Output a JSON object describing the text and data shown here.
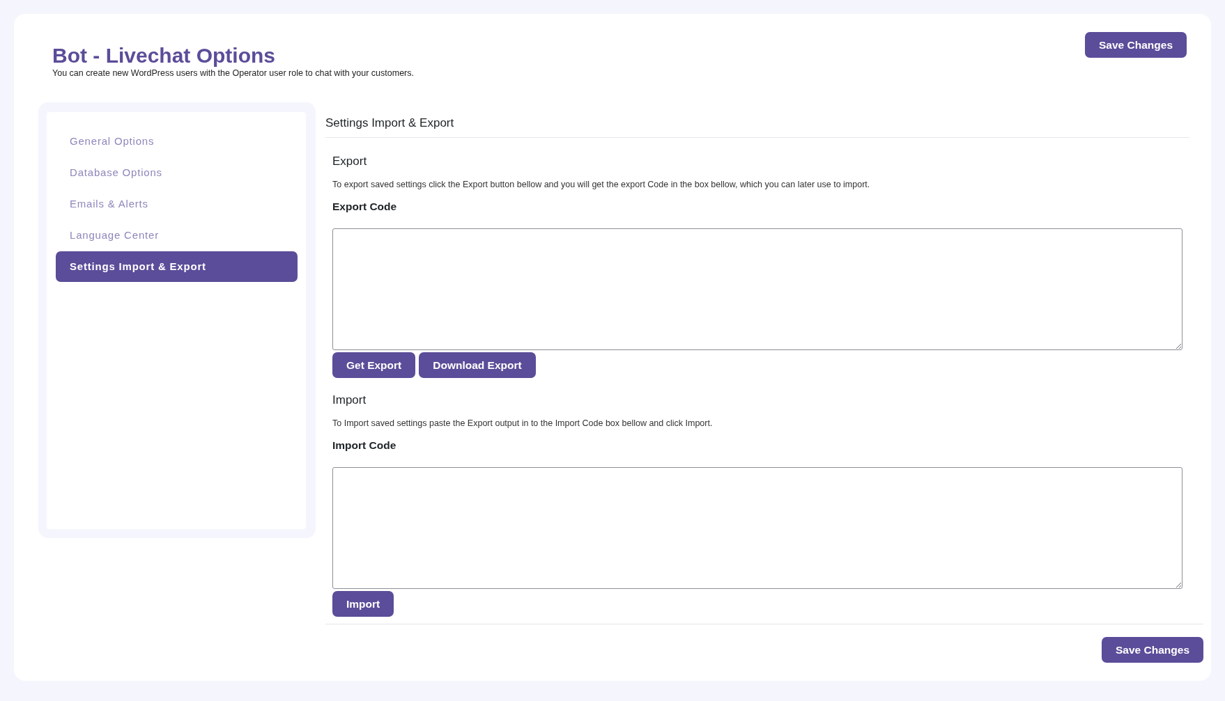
{
  "header": {
    "title": "Bot - Livechat Options",
    "subtitle": "You can create new WordPress users with the Operator user role to chat with your customers.",
    "save_button": "Save Changes"
  },
  "sidebar": {
    "items": [
      {
        "label": "General Options",
        "selected": false
      },
      {
        "label": "Database Options",
        "selected": false
      },
      {
        "label": "Emails & Alerts",
        "selected": false
      },
      {
        "label": "Language Center",
        "selected": false
      },
      {
        "label": "Settings Import & Export",
        "selected": true
      }
    ]
  },
  "main": {
    "title": "Settings Import & Export",
    "sections": [
      {
        "heading": "Export",
        "description": "To export saved settings click the Export button bellow and you will get the export Code in the box bellow, which you can later use to import.",
        "field_label": "Export Code",
        "buttons": [
          "Get Export",
          "Download Export"
        ]
      },
      {
        "heading": "Import",
        "description": "To Import saved settings paste the Export output in to the Import Code box bellow and click Import.",
        "field_label": "Import Code",
        "buttons": [
          "Import"
        ]
      }
    ]
  },
  "footer": {
    "save_button": "Save Changes"
  }
}
